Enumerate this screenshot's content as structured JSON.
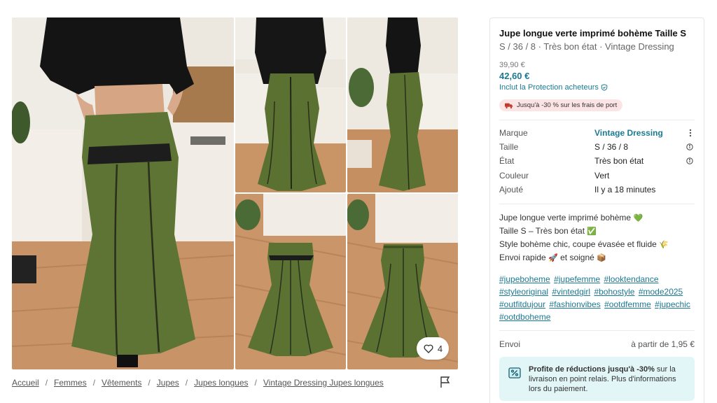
{
  "gallery": {
    "favorite_count": "4"
  },
  "breadcrumb": [
    "Accueil",
    "Femmes",
    "Vêtements",
    "Jupes",
    "Jupes longues",
    "Vintage Dressing Jupes longues"
  ],
  "item": {
    "title": "Jupe longue verte imprimé bohème Taille S",
    "subtitle": "S / 36 / 8 · Très bon état · Vintage Dressing",
    "old_price": "39,90 €",
    "price": "42,60 €",
    "protection": "Inclut la Protection acheteurs",
    "promo": "Jusqu'à -30 % sur les frais de port"
  },
  "details": [
    {
      "label": "Marque",
      "value": "Vintage Dressing"
    },
    {
      "label": "Taille",
      "value": "S / 36 / 8"
    },
    {
      "label": "État",
      "value": "Très bon état"
    },
    {
      "label": "Couleur",
      "value": "Vert"
    },
    {
      "label": "Ajouté",
      "value": "Il y a 18 minutes"
    }
  ],
  "description": {
    "line1": "Jupe longue verte imprimé bohème",
    "line1_emoji": "💚",
    "line2": "Taille S – Très bon état",
    "line2_emoji": "✅",
    "line3": "Style bohème chic, coupe évasée et fluide",
    "line3_emoji": "🌾",
    "line4a": "Envoi rapide",
    "line4_emoji1": "🚀",
    "line4b": "et soigné",
    "line4_emoji2": "📦"
  },
  "hashtags": [
    "#jupeboheme",
    "#jupefemme",
    "#looktendance",
    "#styleoriginal",
    "#vintedgirl",
    "#bohostyle",
    "#mode2025",
    "#outfitdujour",
    "#fashionvibes",
    "#ootdfemme",
    "#jupechic",
    "#ootdboheme"
  ],
  "shipping": {
    "label": "Envoi",
    "value": "à partir de 1,95 €"
  },
  "info_box": {
    "bold": "Profite de réductions jusqu'à -30%",
    "text": " sur la livraison en point relais. Plus d'informations lors du paiement."
  },
  "colors": {
    "accent": "#1b7a92",
    "skirt_green": "#5d7434",
    "promo_bg": "#fde4e4",
    "info_bg": "#e3f6f7"
  }
}
